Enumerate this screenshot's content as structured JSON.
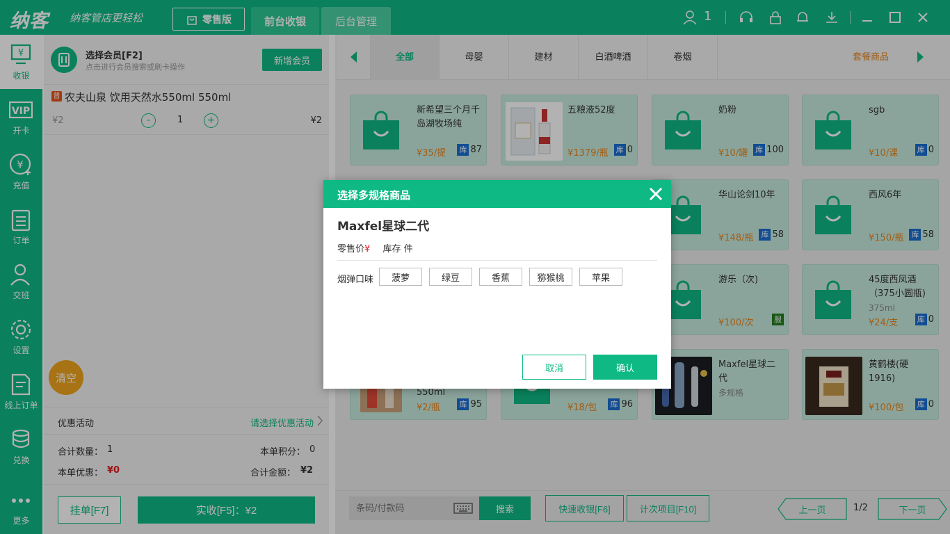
{
  "brand": {
    "logo": "纳客",
    "slogan": "纳客管店更轻松"
  },
  "topbar": {
    "edition": "零售版",
    "tabs": [
      "前台收银",
      "后台管理"
    ],
    "user_count": "1"
  },
  "nav": [
    {
      "label": "收银",
      "icon": "cashier-icon"
    },
    {
      "label": "开卡",
      "icon": "vip-card-icon"
    },
    {
      "label": "充值",
      "icon": "recharge-icon"
    },
    {
      "label": "订单",
      "icon": "order-icon"
    },
    {
      "label": "交班",
      "icon": "handover-icon"
    },
    {
      "label": "设置",
      "icon": "settings-icon"
    },
    {
      "label": "线上订单",
      "icon": "online-order-icon"
    },
    {
      "label": "兑换",
      "icon": "exchange-icon"
    },
    {
      "label": "更多",
      "icon": "more-icon"
    }
  ],
  "member": {
    "title": "选择会员[F2]",
    "subtitle": "点击进行会员搜索或刷卡操作",
    "new_button": "新增会员"
  },
  "cart": {
    "item": {
      "tag": "普",
      "name": "农夫山泉 饮用天然水550ml 550ml",
      "price": "¥2",
      "minus": "-",
      "plus": "+",
      "qty": "1",
      "total": "¥2"
    },
    "clear_button": "清空",
    "promo_label": "优惠活动",
    "promo_select": "请选择优惠活动",
    "total_qty_label": "合计数量：",
    "total_qty": "1",
    "points_label": "本单积分：",
    "points": "0",
    "discount_label": "本单优惠：",
    "discount": "¥0",
    "total_amount_label": "合计金额：",
    "total_amount": "¥2",
    "hang_button": "挂单[F7]",
    "pay_button": "实收[F5]：¥2"
  },
  "categories": {
    "items": [
      "全部",
      "母婴",
      "建材",
      "白酒啤酒",
      "卷烟"
    ],
    "combo": "套餐商品"
  },
  "products": [
    {
      "name": "新希望三个月千岛湖牧场纯",
      "price": "¥35/提",
      "stock": "87",
      "badge": "库"
    },
    {
      "name": "五粮液52度",
      "price": "¥1379/瓶",
      "stock": "0",
      "badge": "库"
    },
    {
      "name": "奶粉",
      "price": "¥10/罐",
      "stock": "100",
      "badge": "库"
    },
    {
      "name": "sgb",
      "price": "¥10/课",
      "stock": "0",
      "badge": "库"
    },
    {
      "name": "华山论剑10年",
      "price": "¥148/瓶",
      "stock": "58",
      "badge": "库"
    },
    {
      "name": "西风6年",
      "price": "¥150/瓶",
      "stock": "58",
      "badge": "库"
    },
    {
      "name": "游乐（次)",
      "price": "¥100/次",
      "stock": "",
      "badge": "服"
    },
    {
      "name": "45度西凤酒（375小圆瓶)",
      "sub": "375ml",
      "price": "¥24/支",
      "stock": "0",
      "badge": "库"
    },
    {
      "name": "550ml",
      "price": "¥2/瓶",
      "stock": "95",
      "badge": "库"
    },
    {
      "name": "",
      "price": "¥18/包",
      "stock": "96",
      "badge": "库"
    },
    {
      "name": "Maxfel星球二代",
      "sub": "多规格",
      "price": "",
      "stock": "",
      "badge": ""
    },
    {
      "name": "黄鹤楼(硬1916)",
      "price": "¥100/包",
      "stock": "0",
      "badge": "库"
    }
  ],
  "bottombar": {
    "search_placeholder": "条码/付款码",
    "search_button": "搜索",
    "quick_button": "快速收银[F6]",
    "count_button": "计次项目[F10]",
    "prev_page": "上一页",
    "page_info": "1/2",
    "next_page": "下一页"
  },
  "modal": {
    "title": "选择多规格商品",
    "product_name": "Maxfel星球二代",
    "price_label": "零售价",
    "price_symbol": "¥",
    "stock_label": "库存 件",
    "attr_label": "烟弹口味",
    "options": [
      "菠萝",
      "绿豆",
      "香蕉",
      "猕猴桃",
      "苹果"
    ],
    "cancel": "取消",
    "confirm": "确认"
  },
  "colors": {
    "brand": "#0fb984",
    "price": "#e8861e",
    "discount": "#e01b1b",
    "stock_badge": "#1a6fd1",
    "service_badge": "#237b1e"
  }
}
